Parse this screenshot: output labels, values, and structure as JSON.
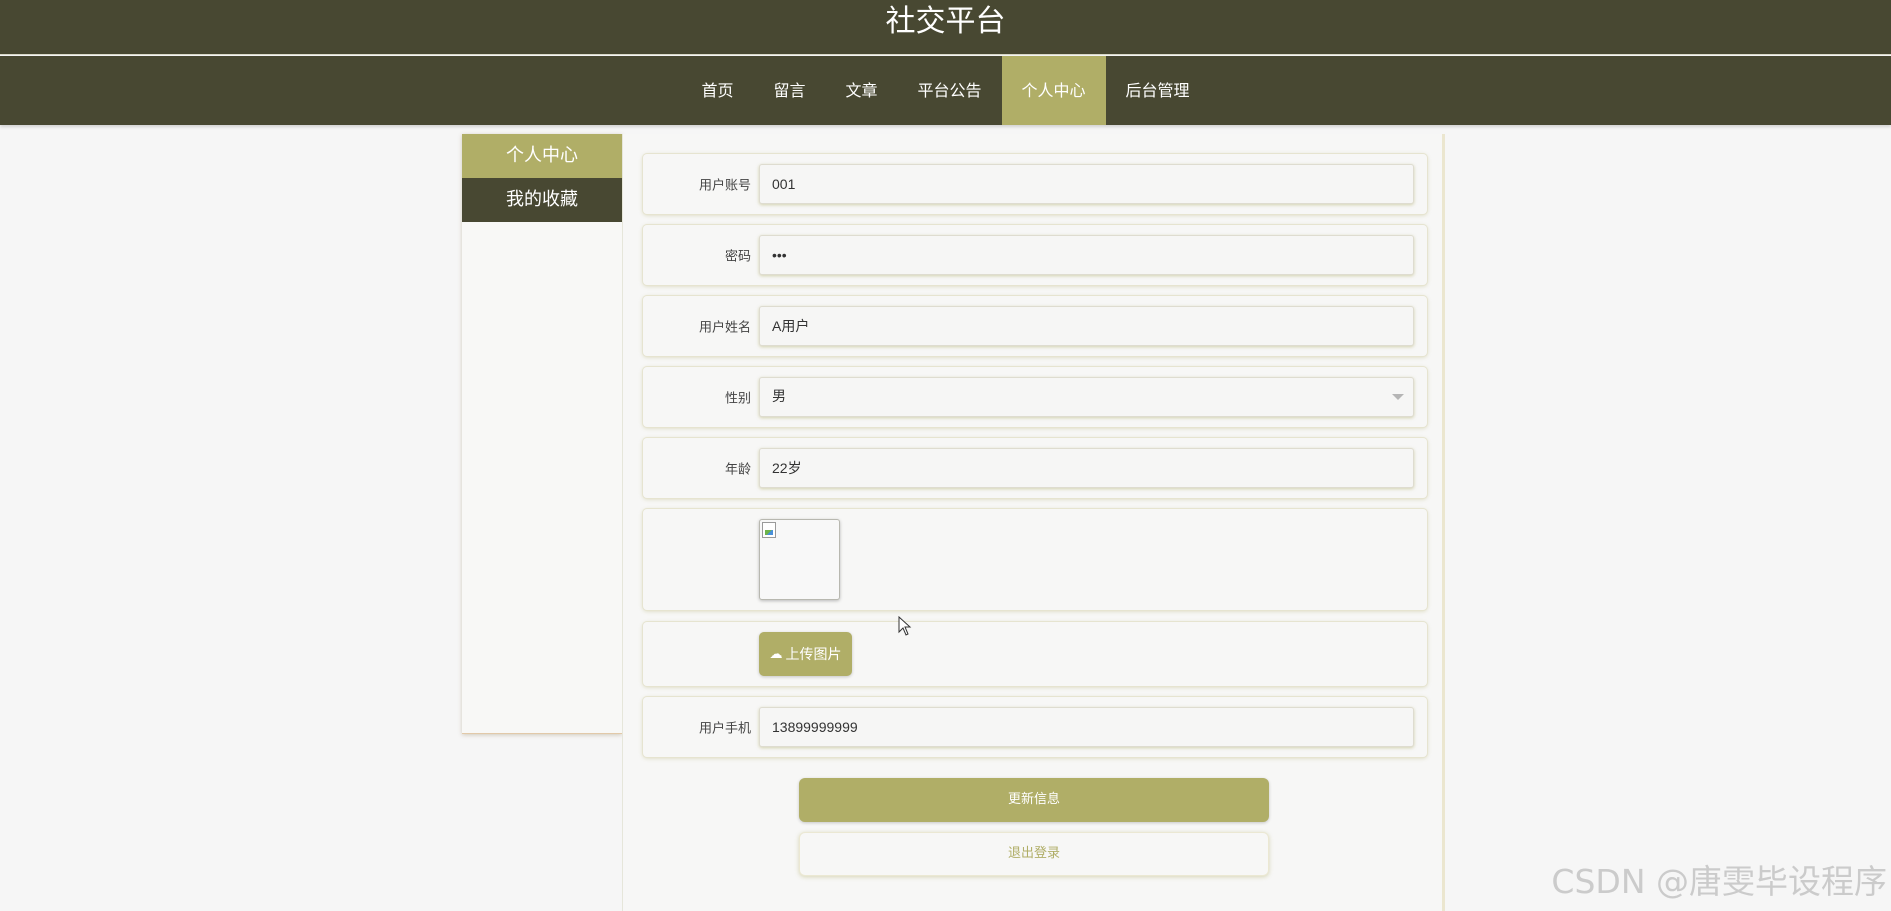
{
  "header": {
    "title": "社交平台"
  },
  "nav": {
    "items": [
      {
        "label": "首页"
      },
      {
        "label": "留言"
      },
      {
        "label": "文章"
      },
      {
        "label": "平台公告"
      },
      {
        "label": "个人中心",
        "active": true
      },
      {
        "label": "后台管理"
      }
    ]
  },
  "sidebar": {
    "items": [
      {
        "label": "个人中心",
        "active": true
      },
      {
        "label": "我的收藏"
      }
    ]
  },
  "form": {
    "account": {
      "label": "用户账号",
      "value": "001"
    },
    "password": {
      "label": "密码",
      "value": "•••"
    },
    "name": {
      "label": "用户姓名",
      "value": "A用户"
    },
    "gender": {
      "label": "性别",
      "value": "男"
    },
    "age": {
      "label": "年龄",
      "value": "22岁"
    },
    "upload_label": "上传图片",
    "phone": {
      "label": "用户手机",
      "value": "13899999999"
    }
  },
  "actions": {
    "update": "更新信息",
    "logout": "退出登录"
  },
  "watermark": "CSDN @唐雯毕设程序",
  "colors": {
    "header_bg": "#484832",
    "accent": "#b0ae67",
    "page_bg": "#f6f6f6"
  },
  "icons": {
    "upload": "cloud-upload-icon",
    "caret": "caret-down-icon",
    "image": "broken-image-icon"
  }
}
